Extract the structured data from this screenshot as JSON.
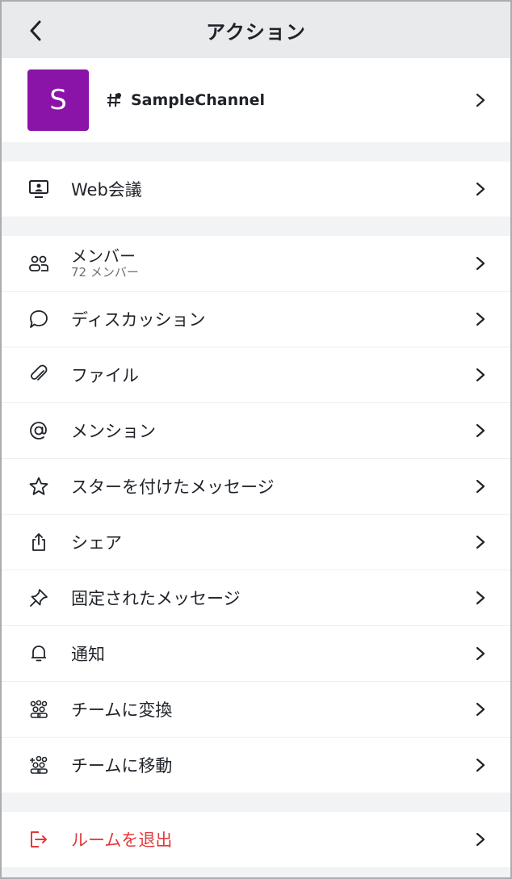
{
  "header": {
    "title": "アクション"
  },
  "channel": {
    "avatar_letter": "S",
    "name": "SampleChannel"
  },
  "web_meeting": {
    "label": "Web会議"
  },
  "members": {
    "label": "メンバー",
    "count": "72 メンバー"
  },
  "menu": {
    "discussion": "ディスカッション",
    "files": "ファイル",
    "mentions": "メンション",
    "starred": "スターを付けたメッセージ",
    "share": "シェア",
    "pinned": "固定されたメッセージ",
    "notifications": "通知",
    "convert_team": "チームに変換",
    "move_team": "チームに移動"
  },
  "leave": {
    "label": "ルームを退出"
  },
  "colors": {
    "avatar": "#8a14a8",
    "danger": "#e23a3a",
    "bg": "#f2f3f5"
  }
}
